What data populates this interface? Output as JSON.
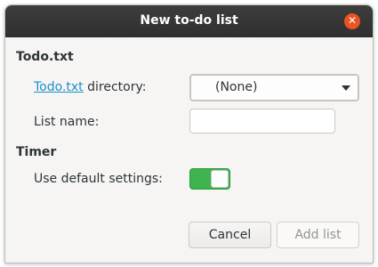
{
  "window": {
    "title": "New to-do list",
    "close_symbol": "✕"
  },
  "todotxt_section": {
    "title": "Todo.txt",
    "directory_link": "Todo.txt",
    "directory_label": "directory:",
    "directory_value": "(None)",
    "list_name_label": "List name:",
    "list_name_value": "",
    "list_name_placeholder": ""
  },
  "timer_section": {
    "title": "Timer",
    "default_settings_label": "Use default settings:",
    "default_settings_on": true
  },
  "buttons": {
    "cancel": "Cancel",
    "add_list": "Add list"
  },
  "colors": {
    "titlebar": "#2f2f2f",
    "close_button": "#e95420",
    "link": "#1a8fc9",
    "switch_on": "#3eb34f"
  }
}
